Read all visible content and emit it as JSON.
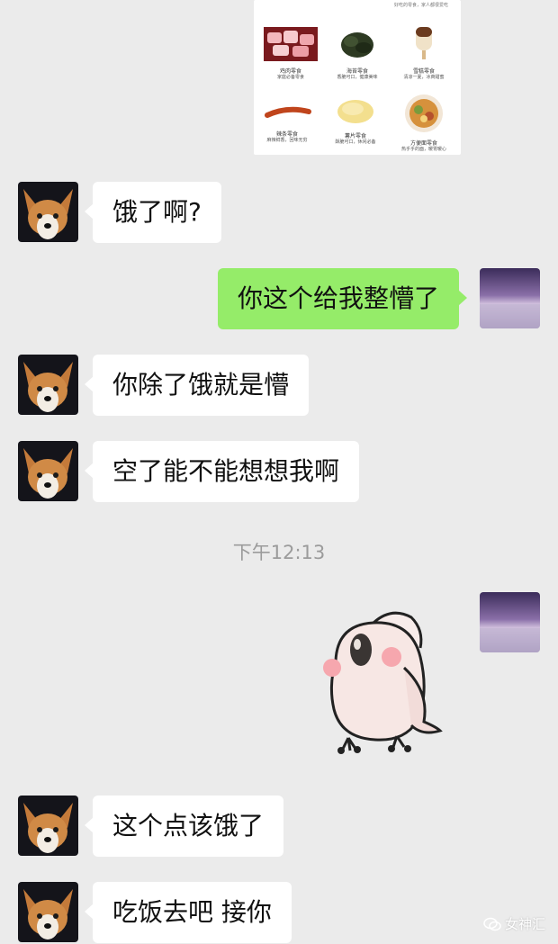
{
  "image_card": {
    "top_caption": "好吃的零食，家人都很爱吃",
    "items": [
      {
        "title": "鸡肉零食",
        "subtitle": "家庭必备零食"
      },
      {
        "title": "海苔零食",
        "subtitle": "香脆可口，健康美味"
      },
      {
        "title": "雪糕零食",
        "subtitle": "清凉一夏，冰爽甜蜜"
      },
      {
        "title": "辣条零食",
        "subtitle": "麻辣鲜香，回味无穷"
      },
      {
        "title": "薯片零食",
        "subtitle": "酥脆可口，休闲必备"
      },
      {
        "title": "方便面零食",
        "subtitle": "热乎乎的面，暖胃暖心"
      }
    ]
  },
  "messages": {
    "m1": "饿了啊?",
    "m2": "你这个给我整懵了",
    "m3": "你除了饿就是懵",
    "m4": "空了能不能想想我啊",
    "m5": "这个点该饿了",
    "m6": "吃饭去吧 接你"
  },
  "timestamp": "下午12:13",
  "watermark": "女神汇",
  "colors": {
    "background": "#ebebeb",
    "bubble_left": "#ffffff",
    "bubble_right": "#95ec69",
    "timestamp_text": "#9b9b9b"
  },
  "icons": {
    "contact_avatar": "corgi-dog-photo",
    "self_avatar": "purple-sky-landscape",
    "sticker": "pink-cockatoo-sticker",
    "watermark_logo": "wechat-bubble-logo"
  }
}
